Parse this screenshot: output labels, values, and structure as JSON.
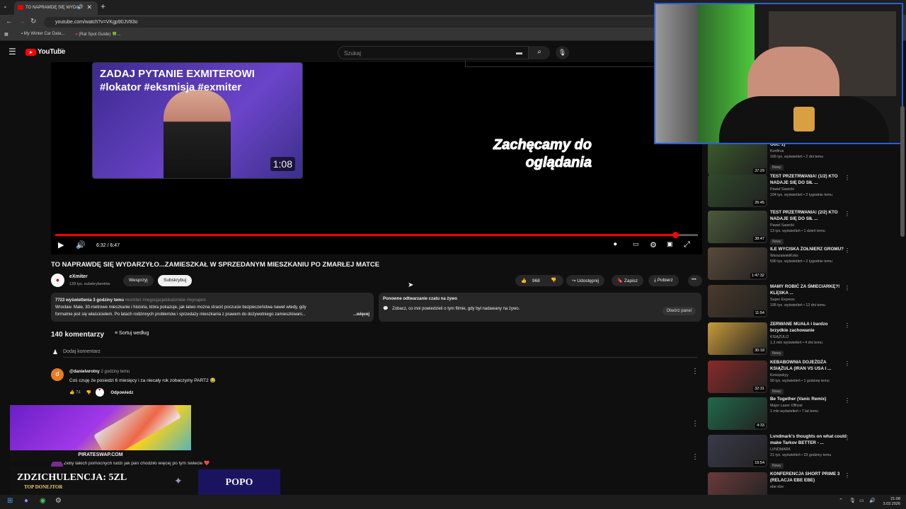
{
  "browser": {
    "tab_title": "TO NAPRAWDĘ SIĘ WYDAR",
    "url": "youtube.com/watch?v=VKgp90JV83o",
    "bookmarks": [
      "My Winter Car Data...",
      "(Rat Spot Guide) 🍀..."
    ],
    "new_tab_symbol": "+",
    "close_symbol": "✕"
  },
  "youtube": {
    "logo_text": "YouTube",
    "logo_sup": "MT",
    "search_placeholder": "Szukaj"
  },
  "player": {
    "endcard_title": "ZADAJ PYTANIE EXMITEROWI\n#lokator #eksmisja #exmiter",
    "endcard_duration": "1:08",
    "watch_text": "Zachęcamy do\noglądania",
    "time": "6:32 / 6:47",
    "progress": 0.965
  },
  "video": {
    "title": "TO NAPRAWDĘ SIĘ WYDARZYŁO...ZAMIESZKAŁ W SPRZEDANYM MIESZKANIU PO ZMARŁEJ MATCE",
    "channel": "eXmiter",
    "subscribers": "139 tys. subskrybentów",
    "support_label": "Wesprzyj",
    "subscribe_label": "Subskrybuj",
    "likes": "968",
    "share_label": "Udostępnij",
    "save_label": "Zapisz",
    "download_label": "Pobierz"
  },
  "description": {
    "stats": "7723 wyświetlenia  3 godziny temu",
    "tags": " #exmiter #negocjacjelokatorskie #wynajem",
    "line1": "Wrocław. Małe, 30-metrowe mieszkanie i historia, która pokazuje, jak łatwo można stracić poczucie bezpieczeństwa nawet wtedy, gdy",
    "line2": "formalnie jest się właścicielem. Po latach rodzinnych problemów i sprzedaży mieszkania z prawem do dożywotniego zamieszkiwani...",
    "more": "...więcej"
  },
  "chat_replay": {
    "title": "Ponowne odtwarzanie czatu na żywo",
    "text": "Zobacz, co inni powiedzieli o tym filmie, gdy był nadawany na żywo.",
    "button": "Otwórz panel"
  },
  "comments": {
    "count_label": "140 komentarzy",
    "sort_label": "Sortuj według",
    "add_placeholder": "Dodaj komentarz",
    "first": {
      "author": "@danielwrotny",
      "time": "2 godziny temu",
      "text": "Coś czuję że posiedzi 6 miesięcy i za niecały rok zobaczymy PART2 😂",
      "likes": "74",
      "reply_label": "Odpowiedz",
      "avatar_letter": "d"
    },
    "second_partial": "Żeby takich pomocnych ludzi jak pan chodziło więcej po tym świecie ❤️"
  },
  "sidebar": [
    {
      "title": "Odc. 1)",
      "channel": "Konfirus",
      "views": "166 tys. wyświetleń • 2 dni temu",
      "badge": "Nowy",
      "duration": "37:29",
      "thumb": "#3a5a2a"
    },
    {
      "title": "TEST PRZETRWANIA! (1/2) KTO NADAJE SIĘ DO SIŁ ...",
      "channel": "Paweł Sawicki",
      "views": "104 tys. wyświetleń • 2 tygodnie temu",
      "badge": "",
      "duration": "26:45",
      "thumb": "#2f4a2a"
    },
    {
      "title": "TEST PRZETRWANIA! (2/2) KTO NADAJE SIĘ DO SIŁ ...",
      "channel": "Paweł Sawicki",
      "views": "13 tys. wyświetleń • 1 dzień temu",
      "badge": "Nowy",
      "duration": "38:47",
      "thumb": "#4a5a3a"
    },
    {
      "title": "ILE WYCISKA ŻOŁNIERZ GROMU?",
      "channel": "WarszawskiKoks",
      "views": "590 tys. wyświetleń • 2 tygodnie temu",
      "badge": "",
      "duration": "1:47:32",
      "thumb": "#5a4a3a"
    },
    {
      "title": "MAMY ROBIĆ ZA ŚMIECIARKĘ?! KLĘSKA ...",
      "channel": "Super Express",
      "views": "195 tys. wyświetleń • 12 dni temu",
      "badge": "",
      "duration": "11:54",
      "thumb": "#4a3a2a"
    },
    {
      "title": "ZERWANE MUAŁA i bardzo brzydkie zachowanie",
      "channel": "KSIĄŻULO",
      "views": "1,3 mln wyświetleń • 4 dni temu",
      "badge": "Nowy",
      "duration": "30:18",
      "thumb": "#c79a3a"
    },
    {
      "title": "KEBABOWNIA DOJEŻDŻA KSIĄŻULA (IRAN VS USA I ...",
      "channel": "Konopskyy",
      "views": "90 tys. wyświetleń • 1 godzinę temu",
      "badge": "Nowy",
      "duration": "32:31",
      "thumb": "#8a2a2a"
    },
    {
      "title": "Be Together (Vanic Remix)",
      "channel": "Major Lazer Official",
      "views": "1 mln wyświetleń • 7 lat temu",
      "badge": "",
      "duration": "4:33",
      "thumb": "#1f6a4a"
    },
    {
      "title": "Lvndmark's thoughts on what could make Tarkov BETTER - ...",
      "channel": "LVNDMARK",
      "views": "21 tys. wyświetleń • 23 godziny temu",
      "badge": "Nowy",
      "duration": "19:54",
      "thumb": "#3a3a4a"
    },
    {
      "title": "KONFERENCJA SHORT PRIME 3 (RELACJA EBE EBE)",
      "channel": "ebe ebe",
      "views": "",
      "badge": "",
      "duration": "",
      "thumb": "#6a3a3a"
    }
  ],
  "overlay": {
    "ad_label": "PIRATESWAP.COM",
    "donation_title": "ZDZICHULENCJA: 5ZL",
    "donation_sub": "TOP DONEJTOR",
    "donation_name": "POPO"
  },
  "taskbar": {
    "time": "21:08",
    "date": "3.03.2026"
  }
}
